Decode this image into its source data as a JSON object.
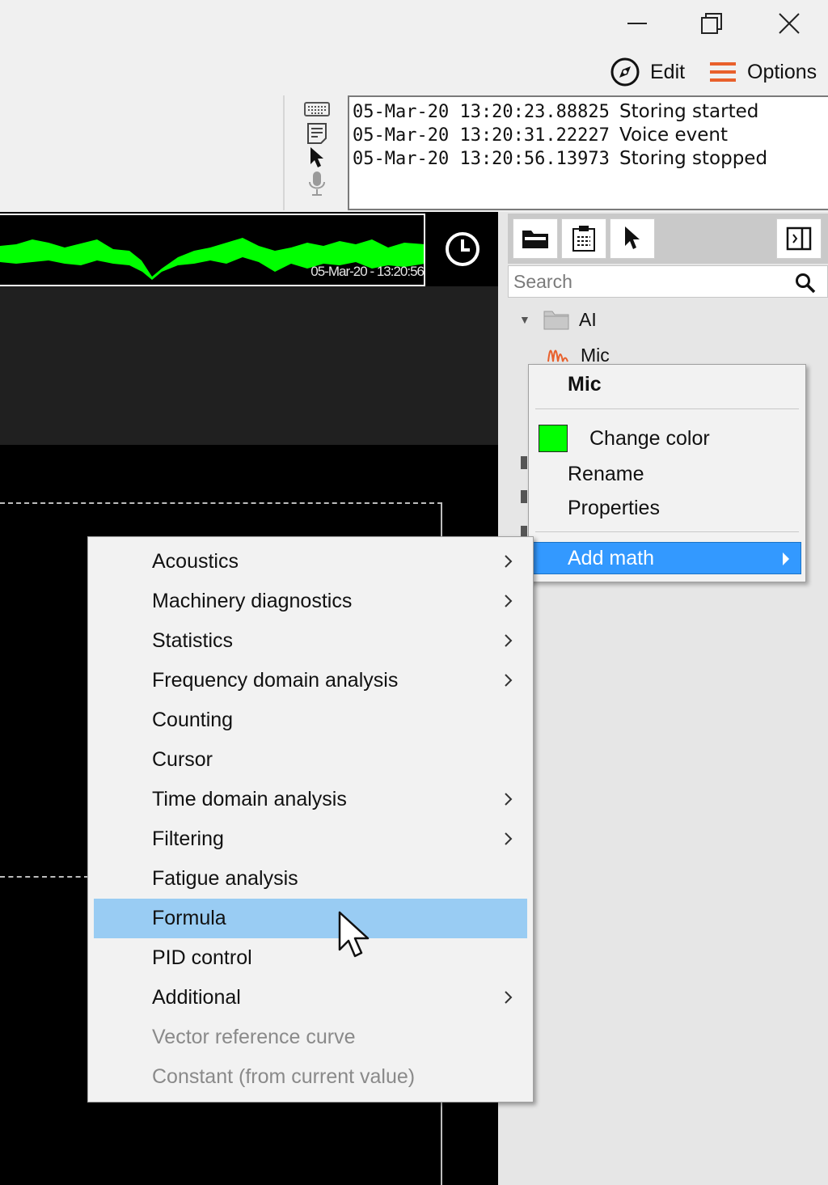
{
  "window": {
    "controls": {
      "minimize": "minimize",
      "maximize": "restore",
      "close": "close"
    }
  },
  "header": {
    "edit_label": "Edit",
    "options_label": "Options",
    "options_color": "#e8602c"
  },
  "event_log": [
    {
      "time": "05-Mar-20 13:20:23.88825",
      "text": "Storing started"
    },
    {
      "time": "05-Mar-20 13:20:31.22227",
      "text": "Voice event"
    },
    {
      "time": "05-Mar-20 13:20:56.13973",
      "text": "Storing stopped"
    }
  ],
  "event_icons": [
    "keyboard-icon",
    "note-icon",
    "pointer-icon",
    "microphone-icon"
  ],
  "overview": {
    "timestamp": "05-Mar-20 - 13:20:56",
    "signal_color": "#00ff00"
  },
  "channel_panel": {
    "toolbar": [
      "folder-icon",
      "clipboard-icon",
      "pointer-icon",
      "panel-toggle-icon"
    ],
    "search": {
      "placeholder": "Search",
      "value": ""
    },
    "tree": {
      "group": "AI",
      "channel": "Mic"
    }
  },
  "context_menu": {
    "title": "Mic",
    "items": [
      {
        "label": "Change color",
        "color": "#00ff00"
      },
      {
        "label": "Rename"
      },
      {
        "label": "Properties"
      },
      {
        "label": "Add math",
        "active": true
      }
    ]
  },
  "math_submenu": {
    "items": [
      {
        "label": "Acoustics",
        "submenu": true
      },
      {
        "label": "Machinery diagnostics",
        "submenu": true
      },
      {
        "label": "Statistics",
        "submenu": true
      },
      {
        "label": "Frequency domain analysis",
        "submenu": true
      },
      {
        "label": "Counting",
        "submenu": false
      },
      {
        "label": "Cursor",
        "submenu": false
      },
      {
        "label": "Time domain analysis",
        "submenu": true
      },
      {
        "label": "Filtering",
        "submenu": true
      },
      {
        "label": "Fatigue analysis",
        "submenu": false
      },
      {
        "label": "Formula",
        "submenu": false,
        "highlighted": true
      },
      {
        "label": "PID control",
        "submenu": false
      },
      {
        "label": "Additional",
        "submenu": true
      },
      {
        "label": "Vector reference curve",
        "submenu": false,
        "disabled": true
      },
      {
        "label": "Constant (from current value)",
        "submenu": false,
        "disabled": true
      }
    ]
  },
  "colors": {
    "highlight": "#3399ff",
    "hover": "#99ccf3",
    "graph_bg": "#000000"
  }
}
